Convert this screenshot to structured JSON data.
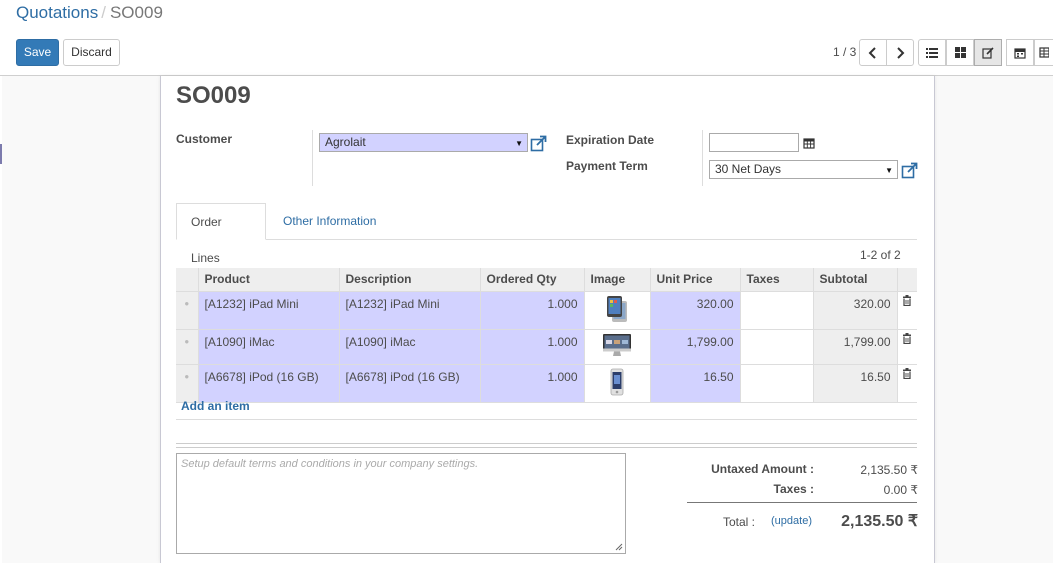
{
  "breadcrumb": {
    "parent": "Quotations",
    "separator": "/",
    "current": "SO009"
  },
  "buttons": {
    "save": "Save",
    "discard": "Discard"
  },
  "pager": {
    "value": "1 / 3"
  },
  "views": [
    "list-icon",
    "kanban-icon",
    "form-icon",
    "calendar-icon",
    "table-icon"
  ],
  "form": {
    "title": "SO009",
    "customer_label": "Customer",
    "customer_value": "Agrolait",
    "expiration_label": "Expiration Date",
    "expiration_value": "",
    "payment_label": "Payment Term",
    "payment_value": "30 Net Days"
  },
  "tabs": [
    "Order Lines",
    "Other Information"
  ],
  "lines": {
    "counter": "1-2 of 2",
    "columns": [
      "Product",
      "Description",
      "Ordered Qty",
      "Image",
      "Unit Price",
      "Taxes",
      "Subtotal"
    ],
    "rows": [
      {
        "product": "[A1232] iPad Mini",
        "description": "[A1232] iPad Mini",
        "qty": "1.000",
        "image": "ipad",
        "unit_price": "320.00",
        "taxes": "",
        "subtotal": "320.00"
      },
      {
        "product": "[A1090] iMac",
        "description": "[A1090] iMac",
        "qty": "1.000",
        "image": "imac",
        "unit_price": "1,799.00",
        "taxes": "",
        "subtotal": "1,799.00"
      },
      {
        "product": "[A6678] iPod (16 GB)",
        "description": "[A6678] iPod (16 GB)",
        "qty": "1.000",
        "image": "ipod",
        "unit_price": "16.50",
        "taxes": "",
        "subtotal": "16.50"
      }
    ],
    "add_item": "Add an item"
  },
  "terms_placeholder": "Setup default terms and conditions in your company settings.",
  "totals": {
    "untaxed_label": "Untaxed Amount :",
    "untaxed_value": "2,135.50 ₹",
    "taxes_label": "Taxes :",
    "taxes_value": "0.00 ₹",
    "total_label": "Total :",
    "update_label": "(update)",
    "total_value": "2,135.50 ₹"
  }
}
